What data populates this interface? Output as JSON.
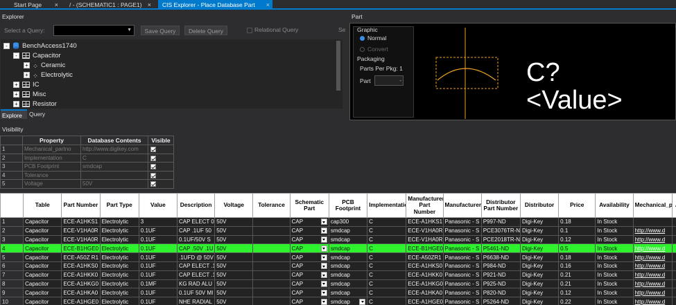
{
  "tabs": [
    {
      "label": "Start Page",
      "active": false
    },
    {
      "label": "/ - (SCHEMATIC1 : PAGE1)",
      "active": false
    },
    {
      "label": "CIS Explorer - Place Database Part",
      "active": true
    }
  ],
  "explorer": {
    "title": "Explorer",
    "select_query_label": "Select a Query:",
    "save_query": "Save Query",
    "delete_query": "Delete Query",
    "relational_query": "Relational Query",
    "se_label": "Se",
    "tree": [
      {
        "label": "BenchAccess1740",
        "level": 0,
        "icon": "database-icon",
        "expander": "-"
      },
      {
        "label": "Capacitor",
        "level": 1,
        "icon": "table-icon",
        "expander": "-"
      },
      {
        "label": "Ceramic",
        "level": 2,
        "icon": "table-icon",
        "expander": "+"
      },
      {
        "label": "Electrolytic",
        "level": 2,
        "icon": "table-icon",
        "expander": "+"
      },
      {
        "label": "IC",
        "level": 1,
        "icon": "table-icon",
        "expander": "+"
      },
      {
        "label": "Misc",
        "level": 1,
        "icon": "table-icon",
        "expander": "+"
      },
      {
        "label": "Resistor",
        "level": 1,
        "icon": "table-icon",
        "expander": "+"
      }
    ],
    "bottom_tabs": [
      "Explore",
      "Query"
    ]
  },
  "part": {
    "title": "Part",
    "graphic_label": "Graphic",
    "normal": "Normal",
    "convert": "Convert",
    "packaging_label": "Packaging",
    "parts_per_pkg": "Parts Per Pkg:  1",
    "part_label": "Part",
    "ref": "C?",
    "value": "<Value>"
  },
  "visibility": {
    "title": "Visibility",
    "headers": [
      "Property",
      "Database Contents",
      "Visible"
    ],
    "rows": [
      {
        "n": "1",
        "property": "Mechanical_partno",
        "contents": "http://www.digikey.com"
      },
      {
        "n": "2",
        "property": "Implementation",
        "contents": "C"
      },
      {
        "n": "3",
        "property": "PCB Footprint",
        "contents": "smdcap"
      },
      {
        "n": "4",
        "property": "Tolerance",
        "contents": ""
      },
      {
        "n": "5",
        "property": "Voltage",
        "contents": "50V"
      }
    ]
  },
  "parts_table": {
    "headers": [
      "Table",
      "Part Number",
      "Part Type",
      "Value",
      "Description",
      "Voltage",
      "Tolerance",
      "Schematic Part",
      "PCB Footprint",
      "Implementation",
      "Manufacturer Part Number",
      "Manufacturer",
      "Distributor Part Number",
      "Distributor",
      "Price",
      "Availability",
      "Mechanical_partno",
      "A"
    ],
    "rows": [
      {
        "n": "1",
        "c": [
          "Capacitor",
          "ECE-A1HKS1",
          "Electrolytic",
          "3",
          "CAP ELECT 0.",
          "50V",
          "",
          "CAP",
          "cap300",
          "C",
          "ECE-A1HKS1",
          "Panasonic - S",
          "P997-ND",
          "Digi-Key",
          "0.18",
          "In Stock",
          "",
          ""
        ]
      },
      {
        "n": "2",
        "c": [
          "Capacitor",
          "ECE-V1HA0R",
          "Electrolytic",
          "0.1UF",
          "CAP .1UF 50",
          "50V",
          "",
          "CAP",
          "smdcap",
          "C",
          "ECE-V1HA0R",
          "Panasonic - S",
          "PCE3076TR-N",
          "Digi-Key",
          "0.1",
          "In Stock",
          "http://www.d",
          ""
        ]
      },
      {
        "n": "3",
        "c": [
          "Capacitor",
          "ECE-V1HA0R",
          "Electrolytic",
          "0.1UF",
          "0.1UF/50V S",
          "50V",
          "",
          "CAP",
          "smdcap",
          "C",
          "ECE-V1HA0R",
          "Panasonic - S",
          "PCE2018TR-N",
          "Digi-Key",
          "0.12",
          "In Stock",
          "http://www.d",
          ""
        ]
      },
      {
        "n": "4",
        "c": [
          "Capacitor",
          "ECE-B1HGE0",
          "Electrolytic",
          "0.1UF",
          "CAP .50V .1U",
          "50V",
          "",
          "CAP",
          "smdcap",
          "C",
          "ECE-B1HGE0",
          "Panasonic - S",
          "P5461-ND",
          "Digi-Key",
          "0.5",
          "In Stock",
          "http://www.d",
          ""
        ],
        "selected": true
      },
      {
        "n": "5",
        "c": [
          "Capacitor",
          "ECE-A50Z R1",
          "Electrolytic",
          "0.1UF",
          ".1UFD @ 50V",
          "50V",
          "",
          "CAP",
          "smdcap",
          "C",
          "ECE-A50ZR1",
          "Panasonic - S",
          "P6638-ND",
          "Digi-Key",
          "0.18",
          "In Stock",
          "http://www.d",
          ""
        ]
      },
      {
        "n": "6",
        "c": [
          "Capacitor",
          "ECE-A1HKS0",
          "Electrolytic",
          "0.1UF",
          "CAP ELECT .1",
          "50V",
          "",
          "CAP",
          "smdcap",
          "C",
          "ECE-A1HKS0",
          "Panasonic - S",
          "P984-ND",
          "Digi-Key",
          "0.16",
          "In Stock",
          "http://www.d",
          ""
        ]
      },
      {
        "n": "7",
        "c": [
          "Capacitor",
          "ECE-A1HKK0",
          "Electrolytic",
          "0.1UF",
          "CAP ELECT .1",
          "50V",
          "",
          "CAP",
          "smdcap",
          "C",
          "ECE-A1HKK0",
          "Panasonic - S",
          "P921-ND",
          "Digi-Key",
          "0.21",
          "In Stock",
          "http://www.d",
          ""
        ]
      },
      {
        "n": "8",
        "c": [
          "Capacitor",
          "ECE-A1HKG0",
          "Electrolytic",
          "0.1MF",
          "KG RAD ALU",
          "50V",
          "",
          "CAP",
          "smdcap",
          "C",
          "ECE-A1HKG0",
          "Panasonic - S",
          "P925-ND",
          "Digi-Key",
          "0.21",
          "In Stock",
          "http://www.d",
          ""
        ]
      },
      {
        "n": "9",
        "c": [
          "Capacitor",
          "ECE-A1HKA0",
          "Electrolytic",
          "0.1UF",
          "0.1UF 50V MI",
          "50V",
          "",
          "CAP",
          "smdcap",
          "C",
          "ECE-A1HKA0",
          "Panasonic - S",
          "P820-ND",
          "Digi-Key",
          "0.12",
          "In Stock",
          "http://www.d",
          ""
        ]
      },
      {
        "n": "10",
        "c": [
          "Capacitor",
          "ECE-A1HGE0",
          "Electrolytic",
          "0.1UF",
          "NHE RADIAL",
          "50V",
          "",
          "CAP",
          "smdcap",
          "C",
          "ECE-A1HGE0",
          "Panasonic - S",
          "P5264-ND",
          "Digi-Key",
          "0.22",
          "In Stock",
          "http://www.d",
          ""
        ]
      }
    ]
  },
  "colors": {
    "accent": "#007acc",
    "selected_row": "#2df22d",
    "symbol": "#f0a020"
  }
}
